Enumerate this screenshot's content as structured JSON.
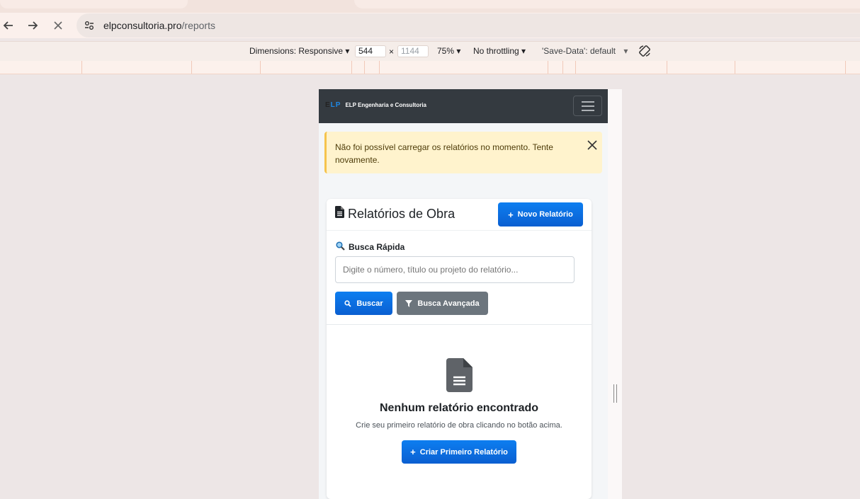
{
  "browser": {
    "url_host": "elpconsultoria.pro",
    "url_path": "/reports"
  },
  "device_toolbar": {
    "dimensions_label": "Dimensions: Responsive",
    "width_value": "544",
    "times": "×",
    "height_placeholder": "1144",
    "zoom": "75%",
    "throttling": "No throttling",
    "save_data": "'Save-Data': default"
  },
  "app": {
    "brand_logo": "ELP",
    "brand_name": "ELP Engenharia e Consultoria",
    "alert_message": "Não foi possível carregar os relatórios no momento. Tente novamente.",
    "alert_close": "×",
    "card_title": "Relatórios de Obra",
    "new_report_button": "Novo Relatório",
    "search_label": "Busca Rápida",
    "search_placeholder": "Digite o número, título ou projeto do relatório...",
    "search_button": "Buscar",
    "advanced_search_button": "Busca Avançada",
    "empty_title": "Nenhum relatório encontrado",
    "empty_subtitle": "Crie seu primeiro relatório de obra clicando no botão acima.",
    "create_first_button": "Criar Primeiro Relatório",
    "plus": "+"
  },
  "colors": {
    "primary": "#0d6efd",
    "secondary": "#6c757d",
    "navbar": "#343a40",
    "alert_bg": "#fff3cd"
  }
}
